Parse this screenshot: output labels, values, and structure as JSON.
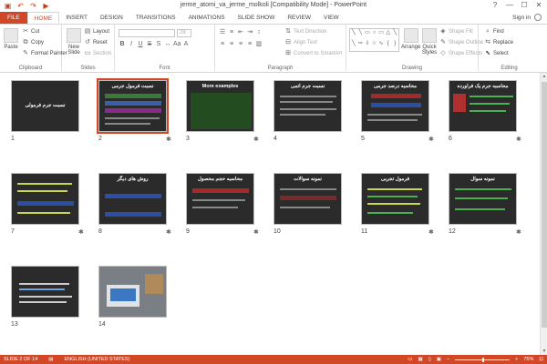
{
  "titlebar": {
    "title": "jerme_atomi_va_jerme_molkoli [Compatibility Mode] - PowerPoint",
    "qat": [
      "save-icon",
      "undo-icon",
      "redo-icon",
      "start-from-beginning-icon"
    ],
    "help": "?",
    "min": "—",
    "max": "☐",
    "close": "✕"
  },
  "tabs": [
    "FILE",
    "HOME",
    "INSERT",
    "DESIGN",
    "TRANSITIONS",
    "ANIMATIONS",
    "SLIDE SHOW",
    "REVIEW",
    "VIEW"
  ],
  "signin": "Sign in",
  "ribbon": {
    "clipboard": {
      "label": "Clipboard",
      "paste": "Paste",
      "cut": "Cut",
      "copy": "Copy",
      "format_painter": "Format Painter"
    },
    "slides": {
      "label": "Slides",
      "new_slide": "New Slide",
      "layout": "Layout",
      "reset": "Reset",
      "section": "Section"
    },
    "font": {
      "label": "Font",
      "size": "28"
    },
    "paragraph": {
      "label": "Paragraph",
      "text_direction": "Text Direction",
      "align_text": "Align Text",
      "convert_smartart": "Convert to SmartArt"
    },
    "drawing": {
      "label": "Drawing",
      "arrange": "Arrange",
      "quick_styles": "Quick Styles",
      "shape_fill": "Shape Fill",
      "shape_outline": "Shape Outline",
      "shape_effects": "Shape Effects"
    },
    "editing": {
      "label": "Editing",
      "find": "Find",
      "replace": "Replace",
      "select": "Select"
    }
  },
  "slides": [
    {
      "num": "1",
      "title": "نسبت جرم فرمولی",
      "star": false
    },
    {
      "num": "2",
      "title": "نسبت فرمول جرمی",
      "star": true
    },
    {
      "num": "3",
      "title": "More examples",
      "star": true
    },
    {
      "num": "4",
      "title": "نسبت جرم اتمی",
      "star": false
    },
    {
      "num": "5",
      "title": "محاسبه درصد جرمی",
      "star": true
    },
    {
      "num": "6",
      "title": "محاسبه جرم یک فراورده",
      "star": true
    },
    {
      "num": "7",
      "title": "",
      "star": true
    },
    {
      "num": "8",
      "title": "روش های دیگر",
      "star": true
    },
    {
      "num": "9",
      "title": "محاسبه حجم محصول",
      "star": true
    },
    {
      "num": "10",
      "title": "نمونه سوالات",
      "star": false
    },
    {
      "num": "11",
      "title": "فرمول تجربی",
      "star": true
    },
    {
      "num": "12",
      "title": "نمونه سوال",
      "star": true
    },
    {
      "num": "13",
      "title": "",
      "star": false
    },
    {
      "num": "14",
      "title": "",
      "star": false
    }
  ],
  "status": {
    "slide": "SLIDE 2 OF 14",
    "language": "ENGLISH (UNITED STATES)",
    "zoom": "75%"
  }
}
